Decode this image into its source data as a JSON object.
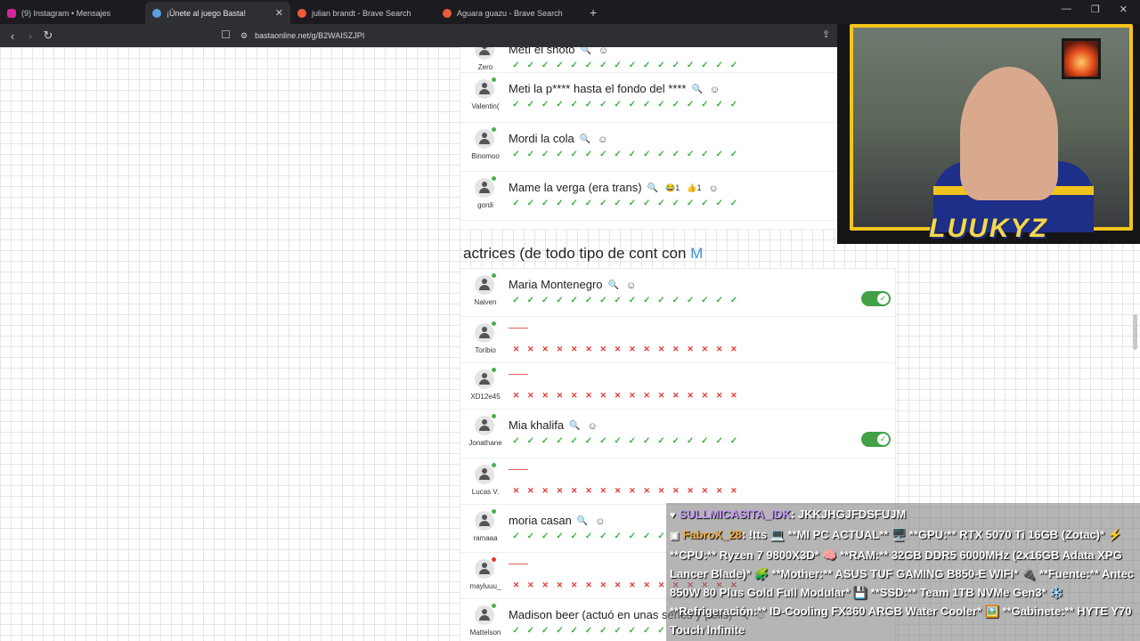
{
  "tabs": [
    {
      "title": "(9) Instagram • Mensajes",
      "color": "#d6249f"
    },
    {
      "title": "¡Únete al juego Basta!",
      "color": "#5aa0e0",
      "active": true
    },
    {
      "title": "julian brandt - Brave Search",
      "color": "#ef5a3a"
    },
    {
      "title": "Aguara guazu - Brave Search",
      "color": "#ef5a3a"
    }
  ],
  "address": {
    "url": "bastaonline.net/g/B2WAISZJPI"
  },
  "category1": {
    "rows": [
      {
        "user": "Zero",
        "answer": "Metí el shoto",
        "marks": "ok"
      },
      {
        "user": "Valentin(",
        "answer": "Meti la p**** hasta el fondo del ****",
        "marks": "ok"
      },
      {
        "user": "Binomoo",
        "answer": "Mordi la cola",
        "marks": "ok"
      },
      {
        "user": "gordi",
        "answer": "Mame la verga (era trans)",
        "badges": [
          "😂1",
          "👍1"
        ],
        "marks": "ok"
      }
    ]
  },
  "category2": {
    "title": "actrices (de todo tipo de cont con ",
    "letter": "M",
    "rows": [
      {
        "user": "Naiven",
        "answer": "Maria Montenegro",
        "marks": "ok",
        "toggle": true
      },
      {
        "user": "Toribio",
        "answer": "",
        "marks": "bad"
      },
      {
        "user": "XD12e45",
        "answer": "",
        "marks": "bad"
      },
      {
        "user": "Jonathane",
        "answer": "Mia khalifa",
        "marks": "ok",
        "toggle": true
      },
      {
        "user": "Lucas V.",
        "answer": "",
        "marks": "bad"
      },
      {
        "user": "ramaaa",
        "answer": "moria casan",
        "marks": "ok"
      },
      {
        "user": "mayluuu_",
        "answer": "",
        "marks": "bad",
        "red": true
      },
      {
        "user": "Mattelson",
        "answer": "Madison beer (actuó en unas series y pelis)",
        "marks": "ok"
      }
    ]
  },
  "cam": {
    "name": "LUUKYZ"
  },
  "chat": {
    "m1_user": "SULLMICASITA_IDK",
    "m1_text": ": JKKJHGJFDSFUJM",
    "m2_user": "FabroX_28",
    "m2_text": ": !tts 💻 **MI PC ACTUAL** 🖥️ **GPU:** RTX 5070 Ti 16GB (Zotac)* ⚡ **CPU:** Ryzen 7 9800X3D* 🧠 **RAM:** 32GB DDR5 6000MHz (2x16GB Adata XPG Lancer Blade)* 🧩 **Mother:** ASUS TUF GAMING B850-E WIFI* 🔌 **Fuente:** Antec 850W 80 Plus Gold Full Modular* 💾 **SSD:** Team 1TB NVMe Gen3* ❄️ **Refrigeración:** ID-Cooling FX360 ARGB Water Cooler* 🖼️ **Gabinete:** HYTE Y70 Touch Infinite"
  }
}
